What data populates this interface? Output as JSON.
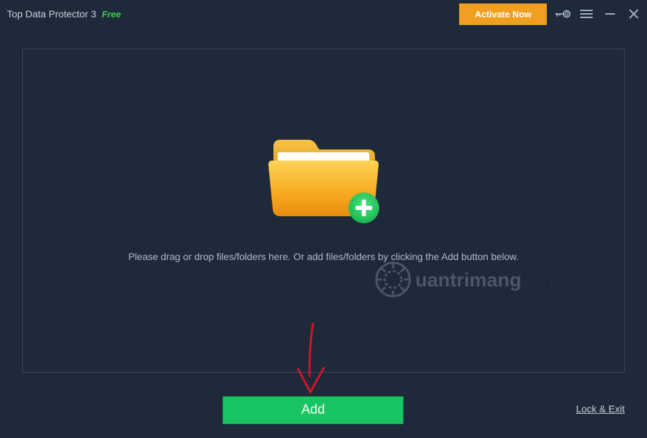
{
  "titlebar": {
    "app_title": "Top Data Protector 3",
    "badge": "Free",
    "activate_label": "Activate Now"
  },
  "main": {
    "instruction": "Please drag or drop files/folders here. Or add files/folders by clicking the Add button below."
  },
  "footer": {
    "add_label": "Add",
    "lock_exit_label": "Lock & Exit"
  },
  "icons": {
    "key": "key-icon",
    "menu": "menu-icon",
    "minimize": "minimize-icon",
    "close": "close-icon",
    "folder_plus": "folder-add-icon"
  },
  "watermark": {
    "text": "Quantrimang"
  },
  "colors": {
    "bg": "#1e2a3a",
    "panel_border": "#3c4a5c",
    "text": "#c9d2dd",
    "muted": "#b0bcc9",
    "accent_green": "#18c562",
    "accent_orange": "#f0a020",
    "badge_green": "#3fcf4a"
  }
}
